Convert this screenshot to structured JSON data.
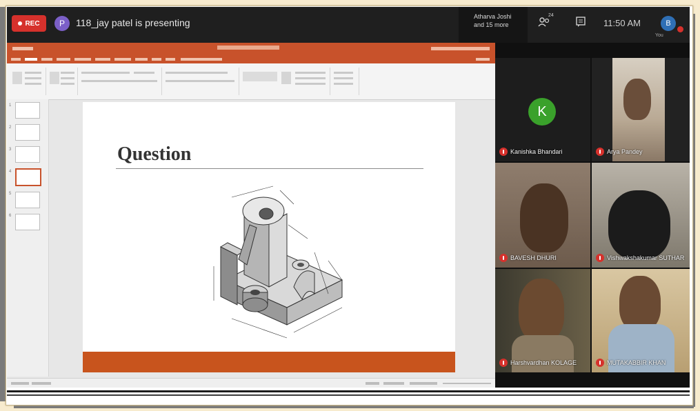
{
  "meeting": {
    "rec_label": "REC",
    "presenter_initial": "P",
    "presenting_text": "118_jay patel is presenting",
    "people_line1": "Atharva Joshi",
    "people_line2": "and 15 more",
    "people_count_badge": "24",
    "time": "11:50 AM",
    "self_initial": "B",
    "self_label": "You"
  },
  "presentation": {
    "slide_title": "Question",
    "slide_count": 6,
    "selected_slide": 4,
    "accent_color": "#c8541d"
  },
  "participants": [
    {
      "name": "Kanishka Bhandari",
      "initial": "K",
      "muted": true,
      "video": false
    },
    {
      "name": "Arya Pandey",
      "muted": true,
      "video": true
    },
    {
      "name": "BAVESH DHURI",
      "muted": true,
      "video": true
    },
    {
      "name": "Vishwakshakumar SUTHAR",
      "muted": true,
      "video": true
    },
    {
      "name": "Harshvardhan KOLAGE",
      "muted": true,
      "video": true
    },
    {
      "name": "MUTAKABBIR KHAN",
      "muted": true,
      "video": true
    }
  ],
  "icons": [
    "record-icon",
    "people-icon",
    "chat-icon",
    "mic-off-icon"
  ],
  "colors": {
    "topbar": "#1f1f1f",
    "rec": "#d6312c",
    "ppt_orange": "#c8522b",
    "avatar_green": "#3aa12b"
  }
}
